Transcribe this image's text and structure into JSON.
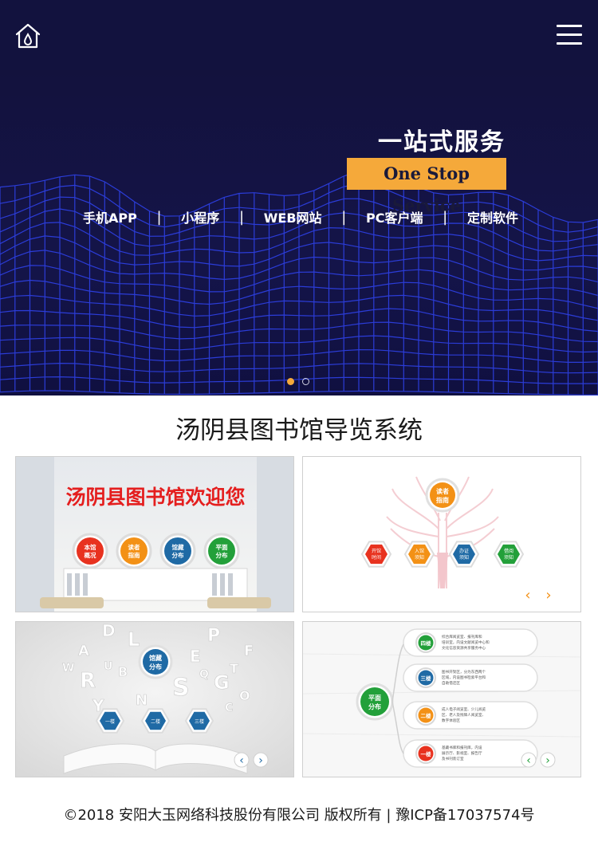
{
  "header": {
    "home_icon": "home-droplet-icon",
    "menu_icon": "hamburger-menu-icon"
  },
  "banner": {
    "title": "一站式服务",
    "subtitle": "One Stop Service",
    "services": [
      "手机APP",
      "小程序",
      "WEB网站",
      "PC客户端",
      "定制软件"
    ],
    "separator": "|",
    "carousel": {
      "active_index": 0,
      "count": 2
    },
    "colors": {
      "background": "#12123e",
      "accent": "#f5a93a",
      "mesh": "#2d3fe0"
    }
  },
  "section": {
    "title": "汤阴县图书馆导览系统"
  },
  "cards": [
    {
      "heading": "汤阴县图书馆欢迎您",
      "buttons": [
        {
          "line1": "本馆",
          "line2": "概况",
          "color": "#e8321f"
        },
        {
          "line1": "读者",
          "line2": "指南",
          "color": "#f39116"
        },
        {
          "line1": "馆藏",
          "line2": "分布",
          "color": "#1f6aa5"
        },
        {
          "line1": "平面",
          "line2": "分布",
          "color": "#23a03a"
        }
      ]
    },
    {
      "top": {
        "line1": "读者",
        "line2": "指南"
      },
      "hexes": [
        {
          "line1": "开馆",
          "line2": "时间",
          "color": "#e8321f"
        },
        {
          "line1": "入馆",
          "line2": "须知",
          "color": "#f39116"
        },
        {
          "line1": "办证",
          "line2": "须知",
          "color": "#1f6aa5"
        },
        {
          "line1": "借阅",
          "line2": "须知",
          "color": "#23a03a"
        }
      ],
      "nav": [
        "‹",
        "›"
      ]
    },
    {
      "top": {
        "line1": "馆藏",
        "line2": "分布"
      },
      "hexes": [
        "一楼",
        "二楼",
        "三楼"
      ],
      "letters": [
        "D",
        "L",
        "P",
        "A",
        "E",
        "F",
        "R",
        "S",
        "G",
        "B",
        "T",
        "Q",
        "Y",
        "N",
        "O",
        "U",
        "C",
        "W"
      ],
      "nav": [
        "‹",
        "›"
      ]
    },
    {
      "center": {
        "line1": "平面",
        "line2": "分布"
      },
      "floors": [
        {
          "label": "四楼",
          "color": "#23a03a",
          "text": [
            "综合库阅览室、报刊库和",
            "培训室，内设文献阅览中心和",
            "文化信息资源共享服务中心"
          ]
        },
        {
          "label": "三楼",
          "color": "#1f6aa5",
          "text": [
            "图书开架区，分为东西两个",
            "区域，内设图书检索平台和",
            "自助借还区"
          ]
        },
        {
          "label": "二楼",
          "color": "#f39116",
          "text": [
            "成人电子阅览室、少儿阅览",
            "区、老人及残障人阅览室、",
            "数字体验区"
          ]
        },
        {
          "label": "一楼",
          "color": "#e8321f",
          "text": [
            "基藏书库和报刊库，内设",
            "展示厅、影视室、报告厅",
            "及书刊装订室"
          ]
        }
      ],
      "nav": [
        "‹",
        "›"
      ]
    }
  ],
  "footer": {
    "text": "©2018 安阳大玉网络科技股份有限公司 版权所有 | 豫ICP备17037574号"
  }
}
